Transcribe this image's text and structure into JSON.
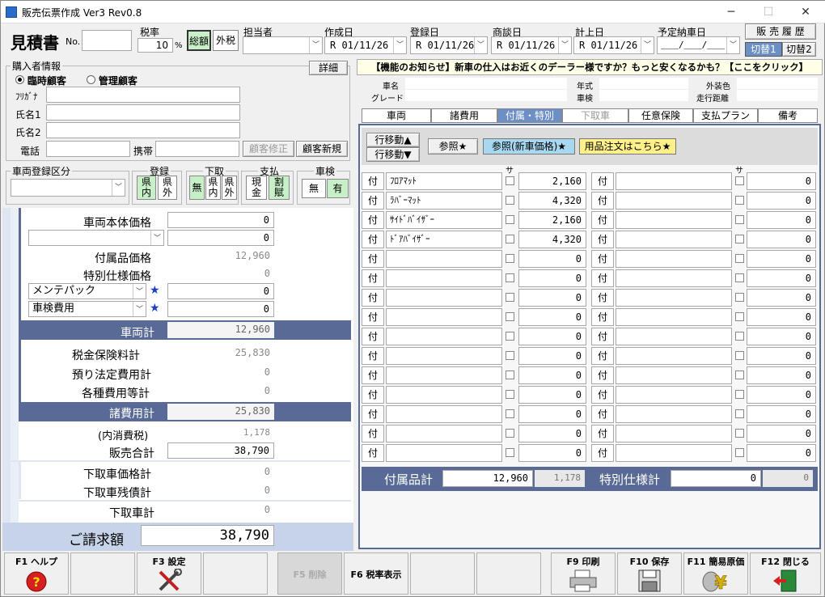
{
  "window": {
    "title": "販売伝票作成 Ver3 Rev0.8",
    "min": "─",
    "max": "☐",
    "close": "✕"
  },
  "header": {
    "doc_type": "見積書",
    "no_label": "No.",
    "no_value": "",
    "tax_label": "税率",
    "tax_value": "10",
    "tax_unit": "%",
    "tax_mode_total": "総額",
    "tax_mode_excl": "外税",
    "staff_label": "担当者",
    "staff_value": "",
    "created_label": "作成日",
    "created_value": "R 01/11/26",
    "registered_label": "登録日",
    "registered_value": "R 01/11/26",
    "negotiation_label": "商談日",
    "negotiation_value": "R 01/11/26",
    "booked_label": "計上日",
    "booked_value": "R 01/11/26",
    "delivery_label": "予定納車日",
    "delivery_value": "＿＿/＿＿/＿＿",
    "history_button": "販 売 履 歴",
    "switch1": "切替1",
    "switch2": "切替2"
  },
  "buyer": {
    "section_label": "購入者情報",
    "detail_button": "詳細",
    "radio_temp": "臨時顧客",
    "radio_managed": "管理顧客",
    "kana_label": "ﾌﾘｶﾞﾅ",
    "name1_label": "氏名1",
    "name2_label": "氏名2",
    "phone_label": "電話",
    "mobile_label": "携帯",
    "edit_button": "顧客修正",
    "new_button": "顧客新規"
  },
  "vehicle_reg": {
    "label": "車両登録区分",
    "reg_label": "登録",
    "reg_opt1": "県\n内",
    "reg_opt2": "県\n外",
    "trade_label": "下取",
    "trade_opt0": "無",
    "trade_opt1": "県\n内",
    "trade_opt2": "県\n外",
    "pay_label": "支払",
    "pay_opt1": "現\n金",
    "pay_opt2": "割\n賦",
    "inspect_label": "車検",
    "inspect_opt1": "無",
    "inspect_opt2": "有"
  },
  "price": {
    "body_label": "車両本体価格",
    "body_value": "0",
    "extra_value": "0",
    "accessory_label": "付属品価格",
    "accessory_value": "12,960",
    "special_label": "特別仕様価格",
    "special_value": "0",
    "maintenance_select": "メンテパック",
    "maintenance_value": "0",
    "inspection_select": "車検費用",
    "inspection_value": "0",
    "vehicle_total_label": "車両計",
    "vehicle_total_value": "12,960",
    "tax_ins_label": "税金保険料計",
    "tax_ins_value": "25,830",
    "legal_label": "預り法定費用計",
    "legal_value": "0",
    "misc_label": "各種費用等計",
    "misc_value": "0",
    "fees_total_label": "諸費用計",
    "fees_total_value": "25,830",
    "consumption_label": "(内消費税)",
    "consumption_value": "1,178",
    "sales_total_label": "販売合計",
    "sales_total_value": "38,790",
    "tradein_price_label": "下取車価格計",
    "tradein_price_value": "0",
    "tradein_debt_label": "下取車残債計",
    "tradein_debt_value": "0",
    "tradein_total_label": "下取車計",
    "tradein_total_value": "0",
    "invoice_label": "ご請求額",
    "invoice_value": "38,790"
  },
  "notice": "【機能のお知らせ】新車の仕入はお近くのデーラー様ですか？もっと安くなるかも？【ここをクリック】",
  "car_info": {
    "name_label": "車名",
    "grade_label": "グレード",
    "year_label": "年式",
    "inspection_label": "車検",
    "color_label": "外装色",
    "mileage_label": "走行距離"
  },
  "tabs": [
    "車両",
    "諸費用",
    "付属・特別",
    "下取車",
    "任意保険",
    "支払プラン",
    "備考"
  ],
  "toolbar": {
    "move_up": "行移動▲",
    "move_down": "行移動▼",
    "ref": "参照★",
    "ref_new": "参照(新車価格)★",
    "order": "用品注文はこちら★"
  },
  "grid": {
    "sa_label": "サ",
    "row_label": "付",
    "left": [
      {
        "name": "ﾌﾛｱﾏｯﾄ",
        "value": "2,160"
      },
      {
        "name": "ﾗﾊﾞｰﾏｯﾄ",
        "value": "4,320"
      },
      {
        "name": "ｻｲﾄﾞﾊﾞｲｻﾞｰ",
        "value": "2,160"
      },
      {
        "name": "ﾄﾞｱﾊﾞｲｻﾞｰ",
        "value": "4,320"
      },
      {
        "name": "",
        "value": "0"
      },
      {
        "name": "",
        "value": "0"
      },
      {
        "name": "",
        "value": "0"
      },
      {
        "name": "",
        "value": "0"
      },
      {
        "name": "",
        "value": "0"
      },
      {
        "name": "",
        "value": "0"
      },
      {
        "name": "",
        "value": "0"
      },
      {
        "name": "",
        "value": "0"
      },
      {
        "name": "",
        "value": "0"
      },
      {
        "name": "",
        "value": "0"
      },
      {
        "name": "",
        "value": "0"
      }
    ],
    "right": [
      {
        "name": "",
        "value": "0"
      },
      {
        "name": "",
        "value": "0"
      },
      {
        "name": "",
        "value": "0"
      },
      {
        "name": "",
        "value": "0"
      },
      {
        "name": "",
        "value": "0"
      },
      {
        "name": "",
        "value": "0"
      },
      {
        "name": "",
        "value": "0"
      },
      {
        "name": "",
        "value": "0"
      },
      {
        "name": "",
        "value": "0"
      },
      {
        "name": "",
        "value": "0"
      },
      {
        "name": "",
        "value": "0"
      },
      {
        "name": "",
        "value": "0"
      },
      {
        "name": "",
        "value": "0"
      },
      {
        "name": "",
        "value": "0"
      },
      {
        "name": "",
        "value": "0"
      }
    ],
    "acc_total_label": "付属品計",
    "acc_total_value": "12,960",
    "acc_tax_value": "1,178",
    "spec_total_label": "特別仕様計",
    "spec_total_value": "0",
    "spec_tax_value": "0"
  },
  "fkeys": [
    {
      "label": "F1 ヘルプ",
      "icon": "help-icon"
    },
    {
      "label": "",
      "icon": ""
    },
    {
      "label": "F3 設定",
      "icon": "tools-icon"
    },
    {
      "label": "",
      "icon": ""
    },
    {
      "label": "F5 削除",
      "icon": ""
    },
    {
      "label": "F6 税率表示",
      "icon": ""
    },
    {
      "label": "",
      "icon": ""
    },
    {
      "label": "",
      "icon": ""
    },
    {
      "label": "F9 印刷",
      "icon": "printer-icon"
    },
    {
      "label": "F10 保存",
      "icon": "floppy-icon"
    },
    {
      "label": "F11 簡易原価",
      "icon": "yen-icon"
    },
    {
      "label": "F12 閉じる",
      "icon": "exit-icon"
    }
  ]
}
